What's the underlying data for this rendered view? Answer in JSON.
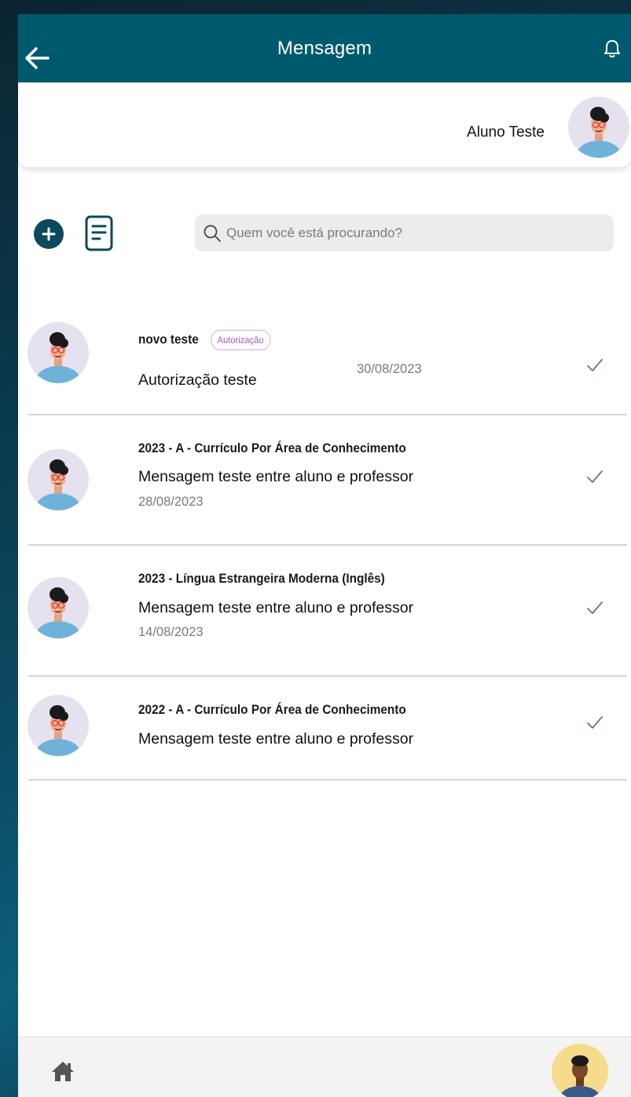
{
  "appbar": {
    "title": "Mensagem",
    "back_icon": "arrow-left-icon",
    "bell_icon": "bell-icon",
    "color": "#005a6e"
  },
  "profile": {
    "name": "Aluno Teste"
  },
  "search": {
    "placeholder": "Quem você está procurando?"
  },
  "messages": [
    {
      "subject": "novo teste",
      "badge": "Autorização",
      "body": "Autorização teste",
      "date": "30/08/2023"
    },
    {
      "subject": "2023 - A - Currículo Por Área de Conhecimento",
      "body": "Mensagem teste entre aluno e professor",
      "date": "28/08/2023"
    },
    {
      "subject": "2023 - Língua Estrangeira Moderna (Inglês)",
      "body": "Mensagem teste entre aluno e professor",
      "date": "14/08/2023"
    },
    {
      "subject": "2022 - A - Currículo Por Área de Conhecimento",
      "body": "Mensagem teste entre aluno e professor",
      "date": ""
    }
  ],
  "colors": {
    "accent": "#005a6e",
    "badge": "#b04fc8",
    "check": "#5a7a86"
  }
}
